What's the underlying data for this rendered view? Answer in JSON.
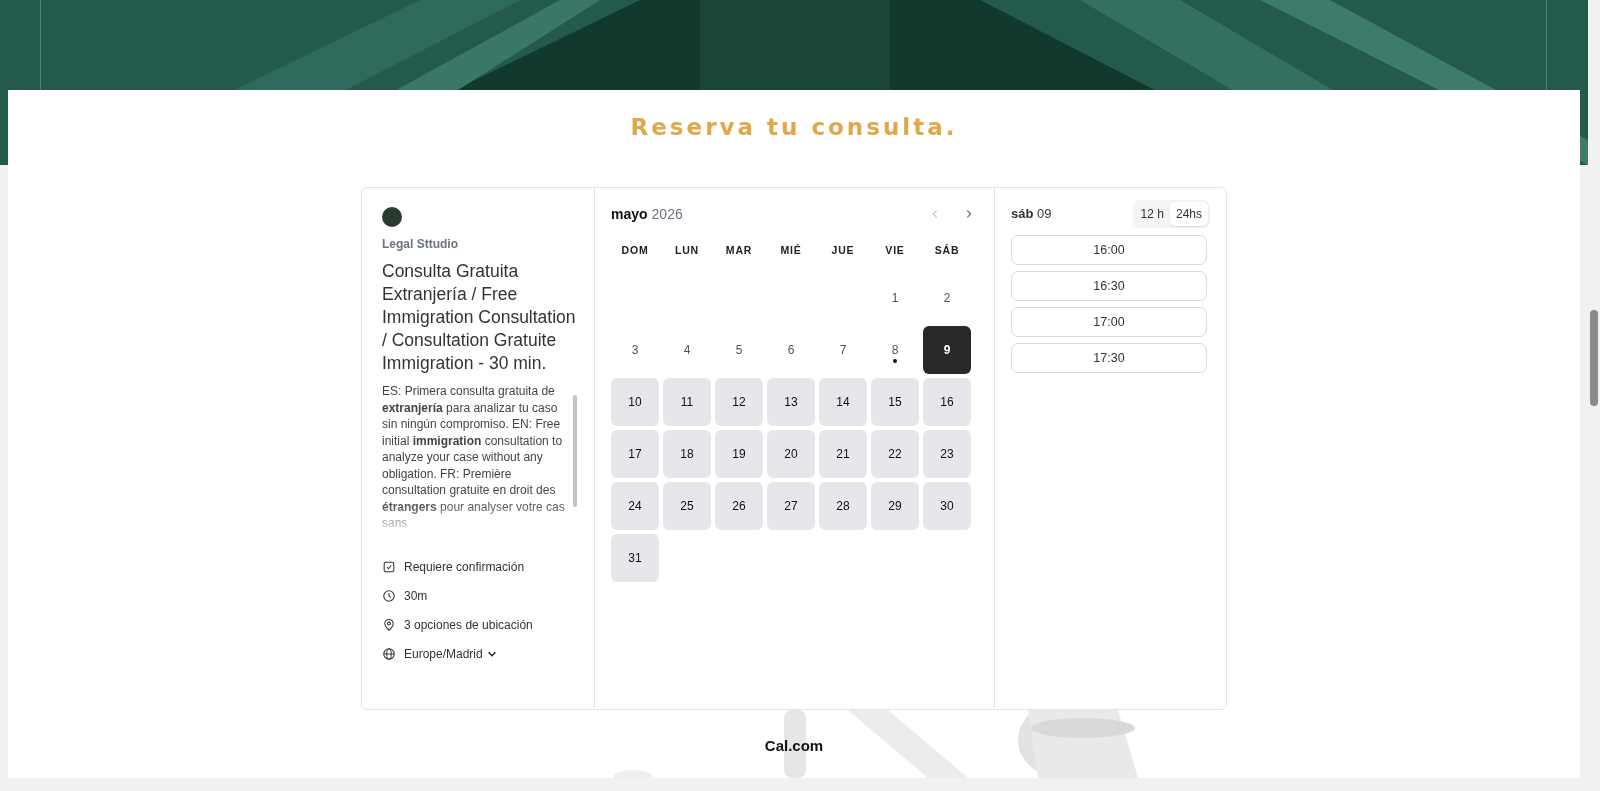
{
  "heading": "Reserva tu consulta.",
  "event": {
    "organizer": "Legal Sttudio",
    "title": "Consulta Gratuita Extranjería / Free Immigration Consultation / Consultation Gratuite Immigration - 30 min.",
    "description": "ES: Primera consulta gratuita de **extranjería** para analizar tu caso sin ningún compromiso. EN: Free initial **immigration** consultation to analyze your case without any obligation. FR: Première consultation gratuite en droit des **étrangers** pour analyser votre cas sans",
    "details": [
      {
        "kind": "confirm",
        "text": "Requiere confirmación"
      },
      {
        "kind": "duration",
        "text": "30m"
      },
      {
        "kind": "location",
        "text": "3 opciones de ubicación"
      },
      {
        "kind": "timezone",
        "text": "Europe/Madrid"
      }
    ]
  },
  "calendar": {
    "month": "mayo",
    "year": "2026",
    "weekdays": [
      "DOM",
      "LUN",
      "MAR",
      "MIÉ",
      "JUE",
      "VIE",
      "SÁB"
    ],
    "weeks": [
      {
        "days": [
          {
            "day": "1",
            "available": false,
            "selected": false,
            "today": false
          },
          {
            "day": "2",
            "available": false,
            "selected": false,
            "today": false
          }
        ]
      },
      {
        "days": [
          {
            "day": "3",
            "available": false,
            "selected": false,
            "today": false
          },
          {
            "day": "4",
            "available": false,
            "selected": false,
            "today": false
          },
          {
            "day": "5",
            "available": false,
            "selected": false,
            "today": false
          },
          {
            "day": "6",
            "available": false,
            "selected": false,
            "today": false
          },
          {
            "day": "7",
            "available": false,
            "selected": false,
            "today": false
          },
          {
            "day": "8",
            "available": false,
            "selected": false,
            "today": true
          },
          {
            "day": "9",
            "available": true,
            "selected": true,
            "today": false
          }
        ]
      },
      {
        "days": [
          {
            "day": "10",
            "available": true,
            "selected": false,
            "today": false
          },
          {
            "day": "11",
            "available": true,
            "selected": false,
            "today": false
          },
          {
            "day": "12",
            "available": true,
            "selected": false,
            "today": false
          },
          {
            "day": "13",
            "available": true,
            "selected": false,
            "today": false
          },
          {
            "day": "14",
            "available": true,
            "selected": false,
            "today": false
          },
          {
            "day": "15",
            "available": true,
            "selected": false,
            "today": false
          },
          {
            "day": "16",
            "available": true,
            "selected": false,
            "today": false
          }
        ]
      },
      {
        "days": [
          {
            "day": "17",
            "available": true,
            "selected": false,
            "today": false
          },
          {
            "day": "18",
            "available": true,
            "selected": false,
            "today": false
          },
          {
            "day": "19",
            "available": true,
            "selected": false,
            "today": false
          },
          {
            "day": "20",
            "available": true,
            "selected": false,
            "today": false
          },
          {
            "day": "21",
            "available": true,
            "selected": false,
            "today": false
          },
          {
            "day": "22",
            "available": true,
            "selected": false,
            "today": false
          },
          {
            "day": "23",
            "available": true,
            "selected": false,
            "today": false
          }
        ]
      },
      {
        "days": [
          {
            "day": "24",
            "available": true,
            "selected": false,
            "today": false
          },
          {
            "day": "25",
            "available": true,
            "selected": false,
            "today": false
          },
          {
            "day": "26",
            "available": true,
            "selected": false,
            "today": false
          },
          {
            "day": "27",
            "available": true,
            "selected": false,
            "today": false
          },
          {
            "day": "28",
            "available": true,
            "selected": false,
            "today": false
          },
          {
            "day": "29",
            "available": true,
            "selected": false,
            "today": false
          },
          {
            "day": "30",
            "available": true,
            "selected": false,
            "today": false
          }
        ]
      },
      {
        "days": [
          {
            "day": "31",
            "available": true,
            "selected": false,
            "today": false
          }
        ]
      }
    ]
  },
  "slots": {
    "date": "**sáb** 09",
    "formats": [
      {
        "label": "12 h",
        "selected": false
      },
      {
        "label": "24hs",
        "selected": true
      }
    ],
    "times": [
      "16:00",
      "16:30",
      "17:00",
      "17:30"
    ]
  },
  "footer": "Cal.com"
}
